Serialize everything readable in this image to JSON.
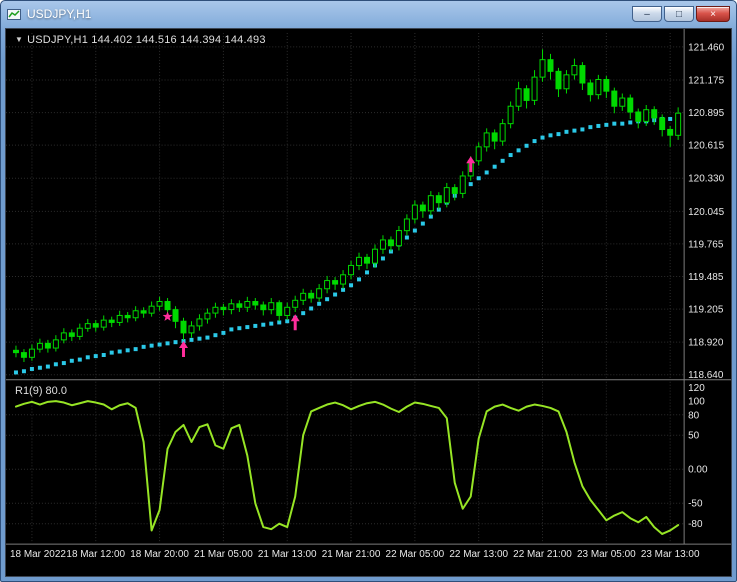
{
  "window": {
    "title": "USDJPY,H1",
    "controls": {
      "minimize": {
        "glyph": "–"
      },
      "maximize": {
        "glyph": "□"
      },
      "close": {
        "glyph": "×"
      }
    }
  },
  "chart": {
    "dropdown_glyph": "▼",
    "symbol_label": "USDJPY,H1 144.402 144.516 144.394 144.493",
    "indicator_label": "R1(9) 80.0"
  },
  "chart_data": [
    {
      "type": "candlestick",
      "symbol": "USDJPY",
      "timeframe": "H1",
      "ohlc_label": {
        "open": "144.402",
        "high": "144.516",
        "low": "144.394",
        "close": "144.493"
      },
      "x_labels": [
        "18 Mar 2022",
        "18 Mar 12:00",
        "18 Mar 20:00",
        "21 Mar 05:00",
        "21 Mar 13:00",
        "21 Mar 21:00",
        "22 Mar 05:00",
        "22 Mar 13:00",
        "22 Mar 21:00",
        "23 Mar 05:00",
        "23 Mar 13:00"
      ],
      "x_label_bar_indices": [
        2,
        10,
        18,
        26,
        34,
        42,
        50,
        58,
        66,
        74,
        82
      ],
      "y_tick_labels": [
        "121.460",
        "121.175",
        "120.895",
        "120.615",
        "120.330",
        "120.045",
        "119.765",
        "119.485",
        "119.205",
        "118.920",
        "118.640"
      ],
      "candles": [
        [
          118.85,
          118.89,
          118.79,
          118.83
        ],
        [
          118.83,
          118.86,
          118.75,
          118.79
        ],
        [
          118.79,
          118.9,
          118.76,
          118.86
        ],
        [
          118.86,
          118.95,
          118.83,
          118.91
        ],
        [
          118.91,
          118.94,
          118.83,
          118.87
        ],
        [
          118.87,
          118.98,
          118.84,
          118.94
        ],
        [
          118.94,
          119.04,
          118.91,
          119.0
        ],
        [
          119.0,
          119.03,
          118.93,
          118.97
        ],
        [
          118.97,
          119.08,
          118.94,
          119.04
        ],
        [
          119.04,
          119.12,
          119.01,
          119.08
        ],
        [
          119.08,
          119.11,
          119.01,
          119.05
        ],
        [
          119.05,
          119.15,
          119.02,
          119.11
        ],
        [
          119.11,
          119.14,
          119.05,
          119.09
        ],
        [
          119.09,
          119.19,
          119.06,
          119.15
        ],
        [
          119.15,
          119.18,
          119.09,
          119.13
        ],
        [
          119.13,
          119.23,
          119.1,
          119.19
        ],
        [
          119.19,
          119.22,
          119.13,
          119.17
        ],
        [
          119.17,
          119.27,
          119.14,
          119.23
        ],
        [
          119.23,
          119.31,
          119.19,
          119.27
        ],
        [
          119.27,
          119.3,
          119.16,
          119.2
        ],
        [
          119.2,
          119.23,
          119.04,
          119.1
        ],
        [
          119.1,
          119.13,
          118.94,
          119.0
        ],
        [
          119.0,
          119.1,
          118.96,
          119.06
        ],
        [
          119.06,
          119.16,
          119.02,
          119.12
        ],
        [
          119.12,
          119.21,
          119.08,
          119.17
        ],
        [
          119.17,
          119.26,
          119.13,
          119.22
        ],
        [
          119.22,
          119.25,
          119.15,
          119.2
        ],
        [
          119.2,
          119.29,
          119.16,
          119.25
        ],
        [
          119.25,
          119.28,
          119.18,
          119.22
        ],
        [
          119.22,
          119.31,
          119.18,
          119.27
        ],
        [
          119.27,
          119.3,
          119.2,
          119.24
        ],
        [
          119.24,
          119.27,
          119.15,
          119.2
        ],
        [
          119.2,
          119.3,
          119.16,
          119.26
        ],
        [
          119.26,
          119.28,
          119.1,
          119.15
        ],
        [
          119.15,
          119.26,
          119.11,
          119.22
        ],
        [
          119.22,
          119.32,
          119.18,
          119.28
        ],
        [
          119.28,
          119.38,
          119.24,
          119.34
        ],
        [
          119.34,
          119.37,
          119.26,
          119.3
        ],
        [
          119.3,
          119.42,
          119.27,
          119.38
        ],
        [
          119.38,
          119.49,
          119.34,
          119.45
        ],
        [
          119.45,
          119.48,
          119.37,
          119.42
        ],
        [
          119.42,
          119.54,
          119.38,
          119.5
        ],
        [
          119.5,
          119.62,
          119.46,
          119.58
        ],
        [
          119.58,
          119.69,
          119.54,
          119.65
        ],
        [
          119.65,
          119.68,
          119.55,
          119.6
        ],
        [
          119.6,
          119.76,
          119.56,
          119.72
        ],
        [
          119.72,
          119.84,
          119.68,
          119.8
        ],
        [
          119.8,
          119.83,
          119.7,
          119.75
        ],
        [
          119.75,
          119.92,
          119.71,
          119.88
        ],
        [
          119.88,
          120.02,
          119.84,
          119.98
        ],
        [
          119.98,
          120.14,
          119.94,
          120.1
        ],
        [
          120.1,
          120.13,
          119.99,
          120.05
        ],
        [
          120.05,
          120.22,
          120.01,
          120.18
        ],
        [
          120.18,
          120.21,
          120.06,
          120.12
        ],
        [
          120.12,
          120.29,
          120.08,
          120.25
        ],
        [
          120.25,
          120.28,
          120.14,
          120.2
        ],
        [
          120.2,
          120.39,
          120.16,
          120.35
        ],
        [
          120.35,
          120.52,
          120.31,
          120.48
        ],
        [
          120.48,
          120.64,
          120.44,
          120.6
        ],
        [
          120.6,
          120.76,
          120.56,
          120.72
        ],
        [
          120.72,
          120.75,
          120.58,
          120.65
        ],
        [
          120.65,
          120.84,
          120.61,
          120.8
        ],
        [
          120.8,
          120.99,
          120.76,
          120.95
        ],
        [
          120.95,
          121.16,
          120.91,
          121.1
        ],
        [
          121.1,
          121.13,
          120.93,
          121.0
        ],
        [
          121.0,
          121.26,
          120.96,
          121.2
        ],
        [
          121.2,
          121.44,
          121.16,
          121.35
        ],
        [
          121.35,
          121.4,
          121.18,
          121.25
        ],
        [
          121.25,
          121.28,
          121.03,
          121.1
        ],
        [
          121.1,
          121.26,
          121.06,
          121.22
        ],
        [
          121.22,
          121.36,
          121.18,
          121.3
        ],
        [
          121.3,
          121.33,
          121.09,
          121.15
        ],
        [
          121.15,
          121.18,
          120.99,
          121.05
        ],
        [
          121.05,
          121.22,
          121.01,
          121.18
        ],
        [
          121.18,
          121.21,
          121.02,
          121.08
        ],
        [
          121.08,
          121.11,
          120.89,
          120.95
        ],
        [
          120.95,
          121.06,
          120.91,
          121.02
        ],
        [
          121.02,
          121.05,
          120.84,
          120.9
        ],
        [
          120.9,
          120.93,
          120.76,
          120.82
        ],
        [
          120.82,
          120.96,
          120.78,
          120.92
        ],
        [
          120.92,
          120.95,
          120.79,
          120.85
        ],
        [
          120.85,
          120.88,
          120.69,
          120.75
        ],
        [
          120.75,
          120.78,
          120.6,
          120.7
        ],
        [
          120.7,
          120.94,
          120.66,
          120.89
        ]
      ],
      "sar_dots": [
        118.66,
        118.67,
        118.69,
        118.7,
        118.71,
        118.73,
        118.74,
        118.76,
        118.77,
        118.79,
        118.8,
        118.81,
        118.83,
        118.84,
        118.85,
        118.86,
        118.88,
        118.89,
        118.9,
        118.91,
        118.92,
        118.93,
        118.94,
        118.95,
        118.96,
        118.98,
        119.0,
        119.03,
        119.04,
        119.05,
        119.06,
        119.07,
        119.08,
        119.09,
        119.1,
        119.13,
        119.17,
        119.21,
        119.25,
        119.29,
        119.33,
        119.37,
        119.41,
        119.46,
        119.52,
        119.58,
        119.64,
        119.7,
        119.76,
        119.82,
        119.88,
        119.94,
        120.0,
        120.06,
        120.12,
        120.18,
        120.23,
        120.28,
        120.33,
        120.38,
        120.43,
        120.48,
        120.53,
        120.57,
        120.61,
        120.65,
        120.68,
        120.7,
        120.71,
        120.73,
        120.74,
        120.75,
        120.77,
        120.78,
        120.79,
        120.8,
        120.8,
        120.81,
        120.82,
        120.82,
        120.83,
        120.84,
        120.84,
        120.85
      ],
      "markers": {
        "up_arrows": [
          {
            "bar": 21,
            "price": 118.93
          },
          {
            "bar": 35,
            "price": 119.16
          },
          {
            "bar": 57,
            "price": 120.52
          }
        ],
        "star": {
          "bar": 19,
          "price": 119.14
        }
      },
      "colors": {
        "candle": "#00d900",
        "sar": "#2bc9e8",
        "marker": "#ff2d9b",
        "grid": "#2d2d2d",
        "axis_text": "#e8e8e8",
        "background": "#000000"
      }
    },
    {
      "type": "line",
      "name": "R1(9)",
      "label": "R1(9) 80.0",
      "y_tick_labels": [
        "120",
        "100",
        "80",
        "50",
        "0.00",
        "-50",
        "-80"
      ],
      "level_lines": [
        80,
        50,
        0,
        -50,
        -80
      ],
      "y_range": [
        -110,
        130
      ],
      "color": "#97e525",
      "values": [
        92,
        96,
        99,
        95,
        99,
        100,
        98,
        94,
        97,
        100,
        98,
        95,
        88,
        94,
        97,
        90,
        40,
        -90,
        -60,
        30,
        55,
        65,
        40,
        62,
        66,
        35,
        30,
        60,
        65,
        20,
        -50,
        -85,
        -88,
        -80,
        -85,
        -40,
        50,
        85,
        90,
        95,
        98,
        94,
        88,
        93,
        97,
        99,
        95,
        89,
        84,
        92,
        98,
        96,
        93,
        90,
        75,
        -20,
        -58,
        -40,
        45,
        85,
        92,
        95,
        90,
        86,
        92,
        95,
        93,
        90,
        85,
        55,
        10,
        -25,
        -45,
        -60,
        -75,
        -68,
        -63,
        -72,
        -78,
        -70,
        -85,
        -95,
        -90,
        -82
      ]
    }
  ]
}
